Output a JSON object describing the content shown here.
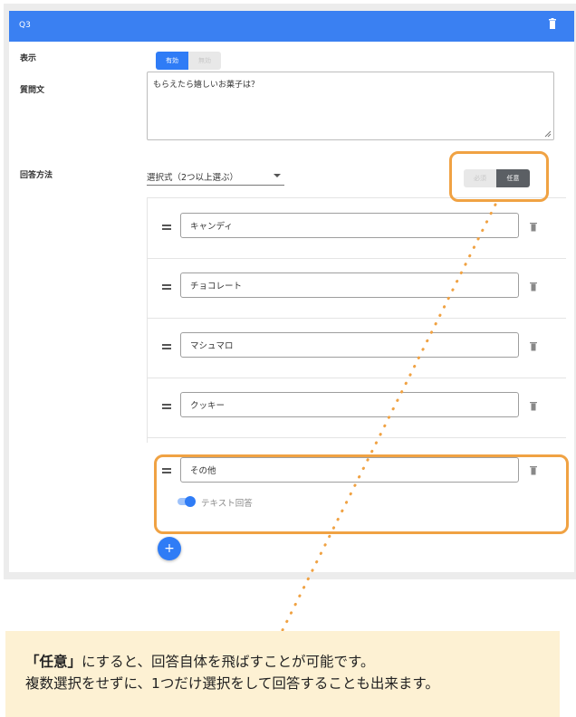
{
  "card": {
    "title": "Q3"
  },
  "labels": {
    "display": "表示",
    "question": "質問文",
    "answer_method": "回答方法"
  },
  "display_toggle": {
    "on": "有効",
    "off": "無効"
  },
  "question_text": "もらえたら嬉しいお菓子は？",
  "answer_select": {
    "value": "選択式（2つ以上選ぶ）"
  },
  "required_toggle": {
    "required": "必須",
    "optional": "任意"
  },
  "options": [
    {
      "value": "キャンディ"
    },
    {
      "value": "チョコレート"
    },
    {
      "value": "マシュマロ"
    },
    {
      "value": "クッキー"
    },
    {
      "value": "その他"
    }
  ],
  "text_answer": {
    "label": "テキスト回答",
    "enabled": true
  },
  "add_button": {
    "symbol": "+"
  },
  "callout": {
    "line1_bold": "「任意」",
    "line1_rest": "にすると、回答自体を飛ばすことが可能です。",
    "line2": "複数選択をせずに、1つだけ選択をして回答することも出来ます。"
  },
  "colors": {
    "accent": "#3a80f2",
    "highlight": "#f0a243",
    "callout_bg": "#fdf1d3",
    "dark_toggle": "#5b5f64"
  },
  "icons": {
    "header_delete": "trash-icon",
    "option_delete": "trash-icon",
    "drag": "drag-handle-icon",
    "add": "plus-icon"
  }
}
